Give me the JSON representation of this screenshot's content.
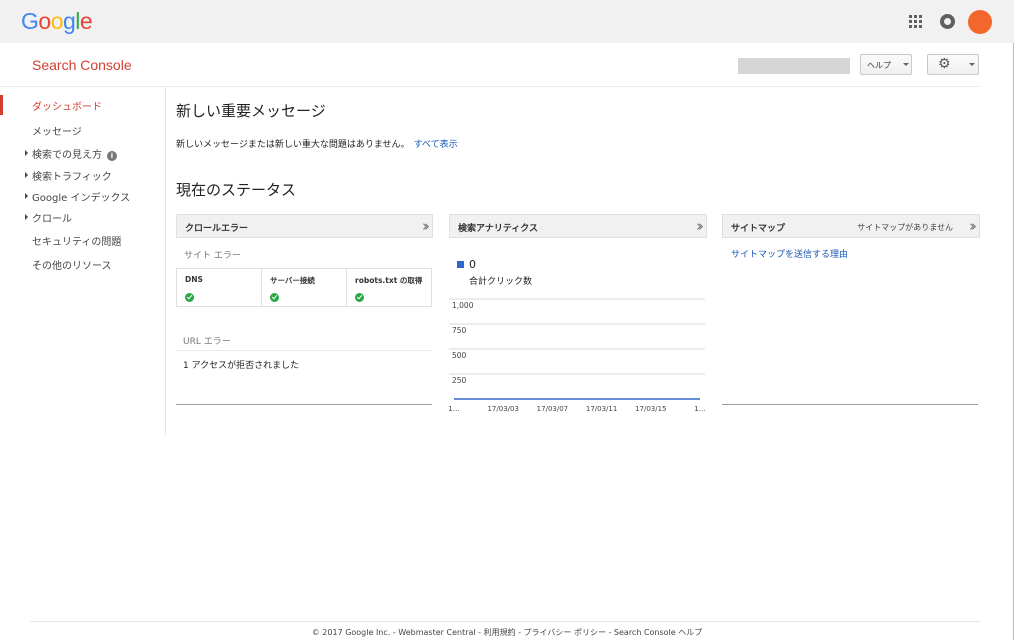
{
  "gbar": {
    "logo_letters": [
      {
        "ch": "G",
        "color": "#4285F4"
      },
      {
        "ch": "o",
        "color": "#EA4335"
      },
      {
        "ch": "o",
        "color": "#FBBC05"
      },
      {
        "ch": "g",
        "color": "#4285F4"
      },
      {
        "ch": "l",
        "color": "#34A853"
      },
      {
        "ch": "e",
        "color": "#EA4335"
      }
    ],
    "avatar_color": "#f4672c"
  },
  "header": {
    "brand": "Search Console",
    "help_label": "ヘルプ"
  },
  "sidebar": {
    "items": [
      {
        "label": "ダッシュボード",
        "active": true,
        "expandable": false
      },
      {
        "label": "メッセージ",
        "active": false,
        "expandable": false
      },
      {
        "label": "検索での見え方",
        "active": false,
        "expandable": true,
        "info": "i"
      },
      {
        "label": "検索トラフィック",
        "active": false,
        "expandable": true
      },
      {
        "label": "Google インデックス",
        "active": false,
        "expandable": true
      },
      {
        "label": "クロール",
        "active": false,
        "expandable": true
      },
      {
        "label": "セキュリティの問題",
        "active": false,
        "expandable": false
      },
      {
        "label": "その他のリソース",
        "active": false,
        "expandable": false
      }
    ]
  },
  "messages": {
    "title": "新しい重要メッセージ",
    "text": "新しいメッセージまたは新しい重大な問題はありません。",
    "link": "すべて表示"
  },
  "status": {
    "title": "現在のステータス",
    "crawl": {
      "title": "クロールエラー",
      "site_errors": "サイト エラー",
      "cells": [
        "DNS",
        "サーバー接続",
        "robots.txt の取得"
      ],
      "url_errors": "URL エラー",
      "url_error_text": "1 アクセスが拒否されました"
    },
    "analytics": {
      "title": "検索アナリティクス",
      "total_value": "0",
      "total_label": "合計クリック数",
      "series_color": "#3366cc"
    },
    "sitemaps": {
      "title": "サイトマップ",
      "note": "サイトマップがありません",
      "link": "サイトマップを送信する理由"
    }
  },
  "chart_data": {
    "type": "line",
    "x": [
      "1…",
      "17/03/03",
      "17/03/07",
      "17/03/11",
      "17/03/15",
      "1…"
    ],
    "series": [
      {
        "values": [
          0,
          0,
          0,
          0,
          0,
          0
        ]
      }
    ],
    "yticks": [
      "1,000",
      "750",
      "500",
      "250"
    ],
    "ytick_values": [
      1000,
      750,
      500,
      250
    ],
    "ylim": [
      0,
      1000
    ],
    "grid": true
  },
  "footer": {
    "text": "© 2017 Google Inc. - Webmaster Central - 利用規約 - プライバシー ポリシー - Search Console ヘルプ"
  }
}
